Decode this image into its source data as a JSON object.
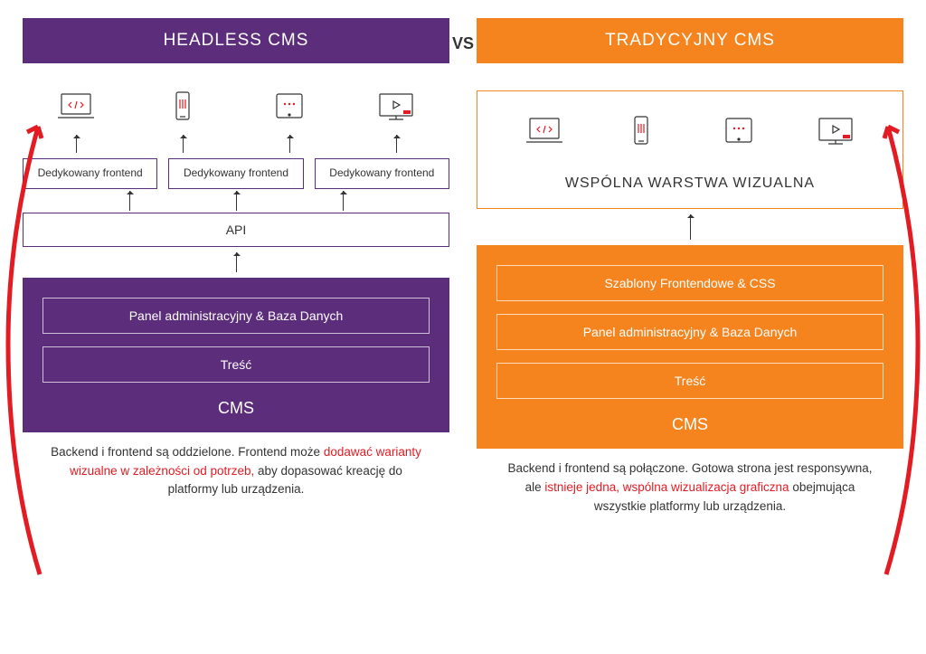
{
  "vs": "VS",
  "left": {
    "header": "HEADLESS CMS",
    "frontend_label": "Dedykowany frontend",
    "api": "API",
    "cms_rows": [
      "Panel administracyjny & Baza Danych",
      "Treść"
    ],
    "cms_title": "CMS",
    "caption_pre": "Backend i frontend są oddzielone. Frontend może ",
    "caption_hl": "dodawać warianty wizualne w zależności od potrzeb,",
    "caption_post": " aby dopasować kreację do platformy lub urządzenia."
  },
  "right": {
    "header": "TRADYCYJNY CMS",
    "visual_label": "WSPÓLNA WARSTWA WIZUALNA",
    "cms_rows": [
      "Szablony Frontendowe & CSS",
      "Panel administracyjny & Baza Danych",
      "Treść"
    ],
    "cms_title": "CMS",
    "caption_pre": "Backend i frontend są połączone. Gotowa strona jest responsywna, ale ",
    "caption_hl": "istnieje jedna, wspólna wizualizacja graficzna",
    "caption_post": " obejmująca wszystkie platformy lub urządzenia."
  },
  "colors": {
    "purple": "#5c2d7a",
    "orange": "#f5841f",
    "red": "#e31b23"
  }
}
